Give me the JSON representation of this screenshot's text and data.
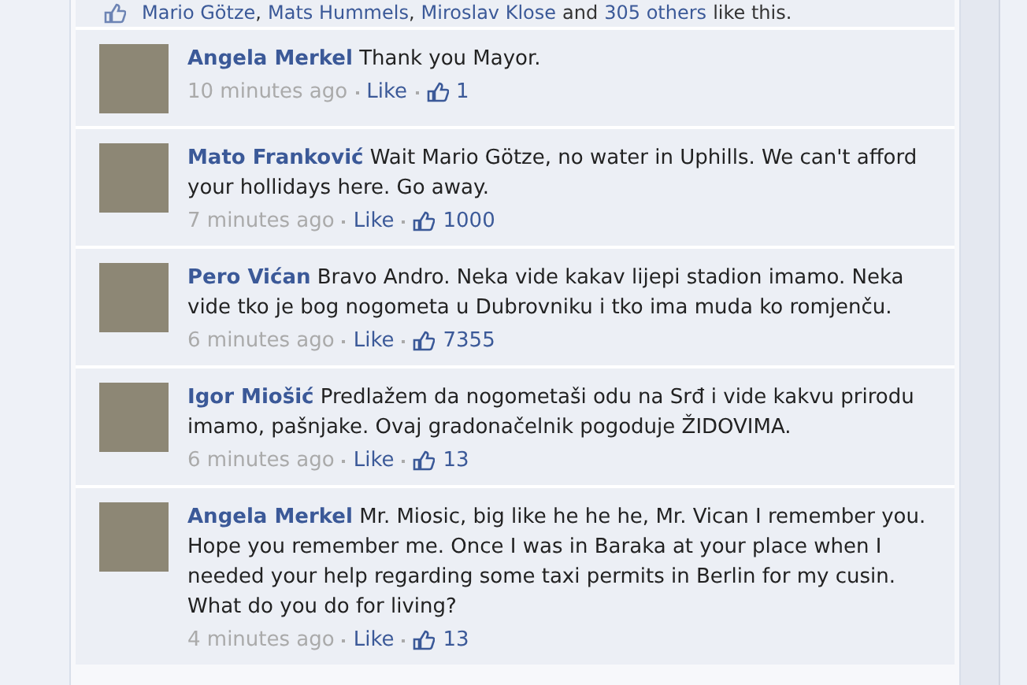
{
  "likes_bar": {
    "parts": [
      {
        "kind": "link",
        "text": "Mario Götze"
      },
      {
        "kind": "plain",
        "text": ","
      },
      {
        "kind": "link",
        "text": "Mats Hummels"
      },
      {
        "kind": "plain",
        "text": ","
      },
      {
        "kind": "link",
        "text": "Miroslav Klose"
      },
      {
        "kind": "plain",
        "text": "and"
      },
      {
        "kind": "link",
        "text": "305 others"
      },
      {
        "kind": "plain",
        "text": "like this."
      }
    ]
  },
  "comments": [
    {
      "author": "Angela Merkel",
      "text": "Thank you Mayor.",
      "time": "10 minutes ago",
      "like": "Like",
      "likes": "1"
    },
    {
      "author": "Mato Franković",
      "text": "Wait Mario Götze, no water in Uphills. We can't afford your hollidays here. Go away.",
      "time": "7 minutes ago",
      "like": "Like",
      "likes": "1000"
    },
    {
      "author": "Pero Vićan",
      "text": "Bravo Andro. Neka vide kakav lijepi stadion imamo. Neka vide tko je bog nogometa u Dubrovniku i tko ima muda ko romjenču.",
      "time": "6 minutes ago",
      "like": "Like",
      "likes": "7355"
    },
    {
      "author": "Igor Miošić",
      "text": "Predlažem da nogometaši odu na Srđ i vide kakvu prirodu imamo, pašnjake. Ovaj gradonačelnik pogoduje ŽIDOVIMA.",
      "time": "6 minutes ago",
      "like": "Like",
      "likes": "13"
    },
    {
      "author": "Angela Merkel",
      "text": "Mr. Miosic, big like he he he, Mr. Vican I remember you. Hope you remember me. Once I was in Baraka at your place when I needed your help regarding some taxi permits in Berlin for my cusin. What do you do for living?",
      "time": "4 minutes ago",
      "like": "Like",
      "likes": "13"
    }
  ]
}
